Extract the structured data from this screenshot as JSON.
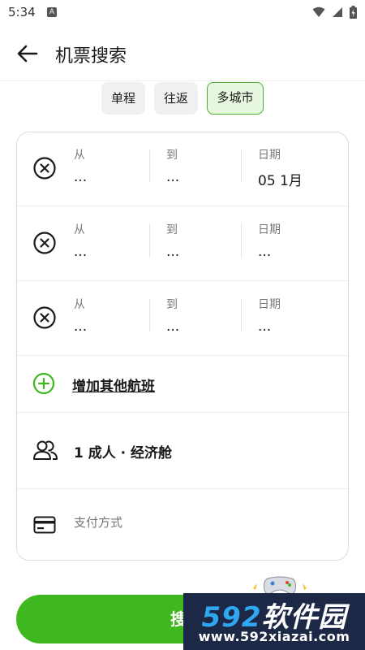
{
  "status_bar": {
    "time": "5:34",
    "notif_icon_letter": "A"
  },
  "app_bar": {
    "title": "机票搜索"
  },
  "mode_tabs": [
    {
      "label": "单程",
      "active": false
    },
    {
      "label": "往返",
      "active": false
    },
    {
      "label": "多城市",
      "active": true
    }
  ],
  "flights": [
    {
      "from_label": "从",
      "from_value": "...",
      "to_label": "到",
      "to_value": "...",
      "date_label": "日期",
      "date_value": "05 1月"
    },
    {
      "from_label": "从",
      "from_value": "...",
      "to_label": "到",
      "to_value": "...",
      "date_label": "日期",
      "date_value": "..."
    },
    {
      "from_label": "从",
      "from_value": "...",
      "to_label": "到",
      "to_value": "...",
      "date_label": "日期",
      "date_value": "..."
    }
  ],
  "add_flight": {
    "label": "增加其他航班"
  },
  "passengers": {
    "label": "1 成人 · 经济舱"
  },
  "payment": {
    "label": "支付方式"
  },
  "search": {
    "label": "搜索"
  },
  "watermark": {
    "brand_num": "592",
    "brand_cn": "软件园",
    "url": "www.592xiazai.com"
  },
  "colors": {
    "accent": "#3fb71e",
    "accent_light": "#e6f6df",
    "watermark_bg": "#1c2846",
    "watermark_num": "#2ea6f0"
  },
  "icons": {
    "back": "arrow-left-icon",
    "remove": "close-circle-icon",
    "add": "plus-circle-icon",
    "passengers": "people-icon",
    "payment": "credit-card-icon"
  }
}
